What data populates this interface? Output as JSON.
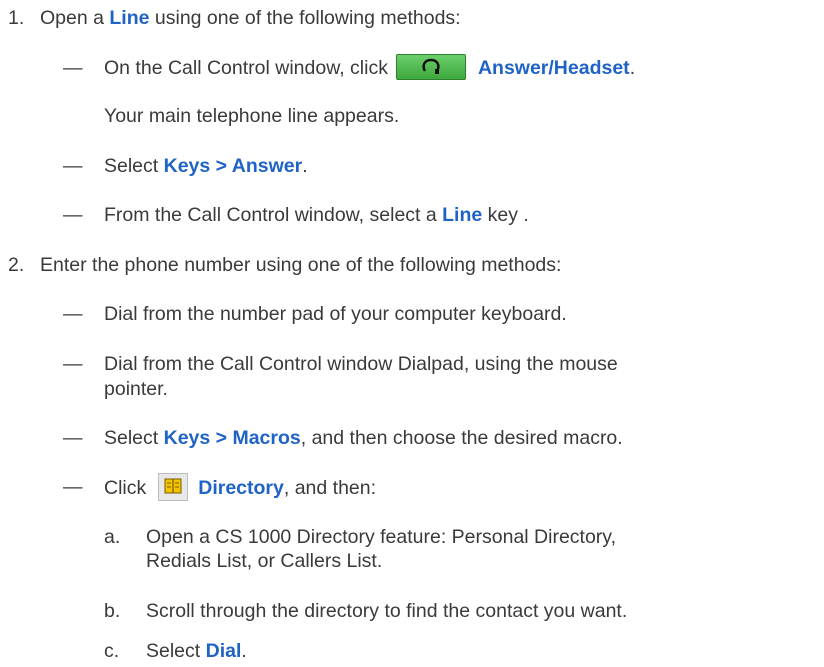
{
  "steps": [
    {
      "number": "1.",
      "text": "Open a ",
      "kw": "Line",
      "after": " using one of the following methods:",
      "methods": [
        {
          "pre": "On the Call Control window, click",
          "icon": "headset-icon",
          "kw": "Answer/Headset",
          "post": "."
        },
        {
          "note": "Your main telephone line appears."
        },
        {
          "pre": "Select ",
          "kw": "Keys > Answer",
          "post": "."
        },
        {
          "pre": "From the Call Control window, select a ",
          "kw": "Line",
          "post": " key ."
        }
      ]
    },
    {
      "number": "2.",
      "text": "Enter the phone number using one of the following methods:",
      "methods": [
        {
          "pre": "Dial from the number pad of your computer keyboard."
        },
        {
          "pre": "Dial from the Call Control window Dialpad, using the mouse",
          "cont": "pointer."
        },
        {
          "pre": "Select ",
          "kw": "Keys > Macros",
          "post": ", and then choose the desired macro."
        },
        {
          "pre": "Click",
          "icon": "book-icon",
          "kw": "Directory",
          "post": ", and then:"
        }
      ],
      "substeps": [
        {
          "label": "a.",
          "line1": "Open a CS 1000 Directory feature: Personal Directory,",
          "line2": "Redials List, or Callers List."
        },
        {
          "label": "b.",
          "line1": "Scroll through the directory to find the contact you want."
        },
        {
          "label": "c.",
          "pre": "Select ",
          "kw": "Dial",
          "post": "."
        }
      ]
    }
  ],
  "dash_char": "—",
  "colors": {
    "text": "#3a3a3a",
    "keyword": "#1f63c6",
    "answer_button": "#4cbc4c"
  }
}
